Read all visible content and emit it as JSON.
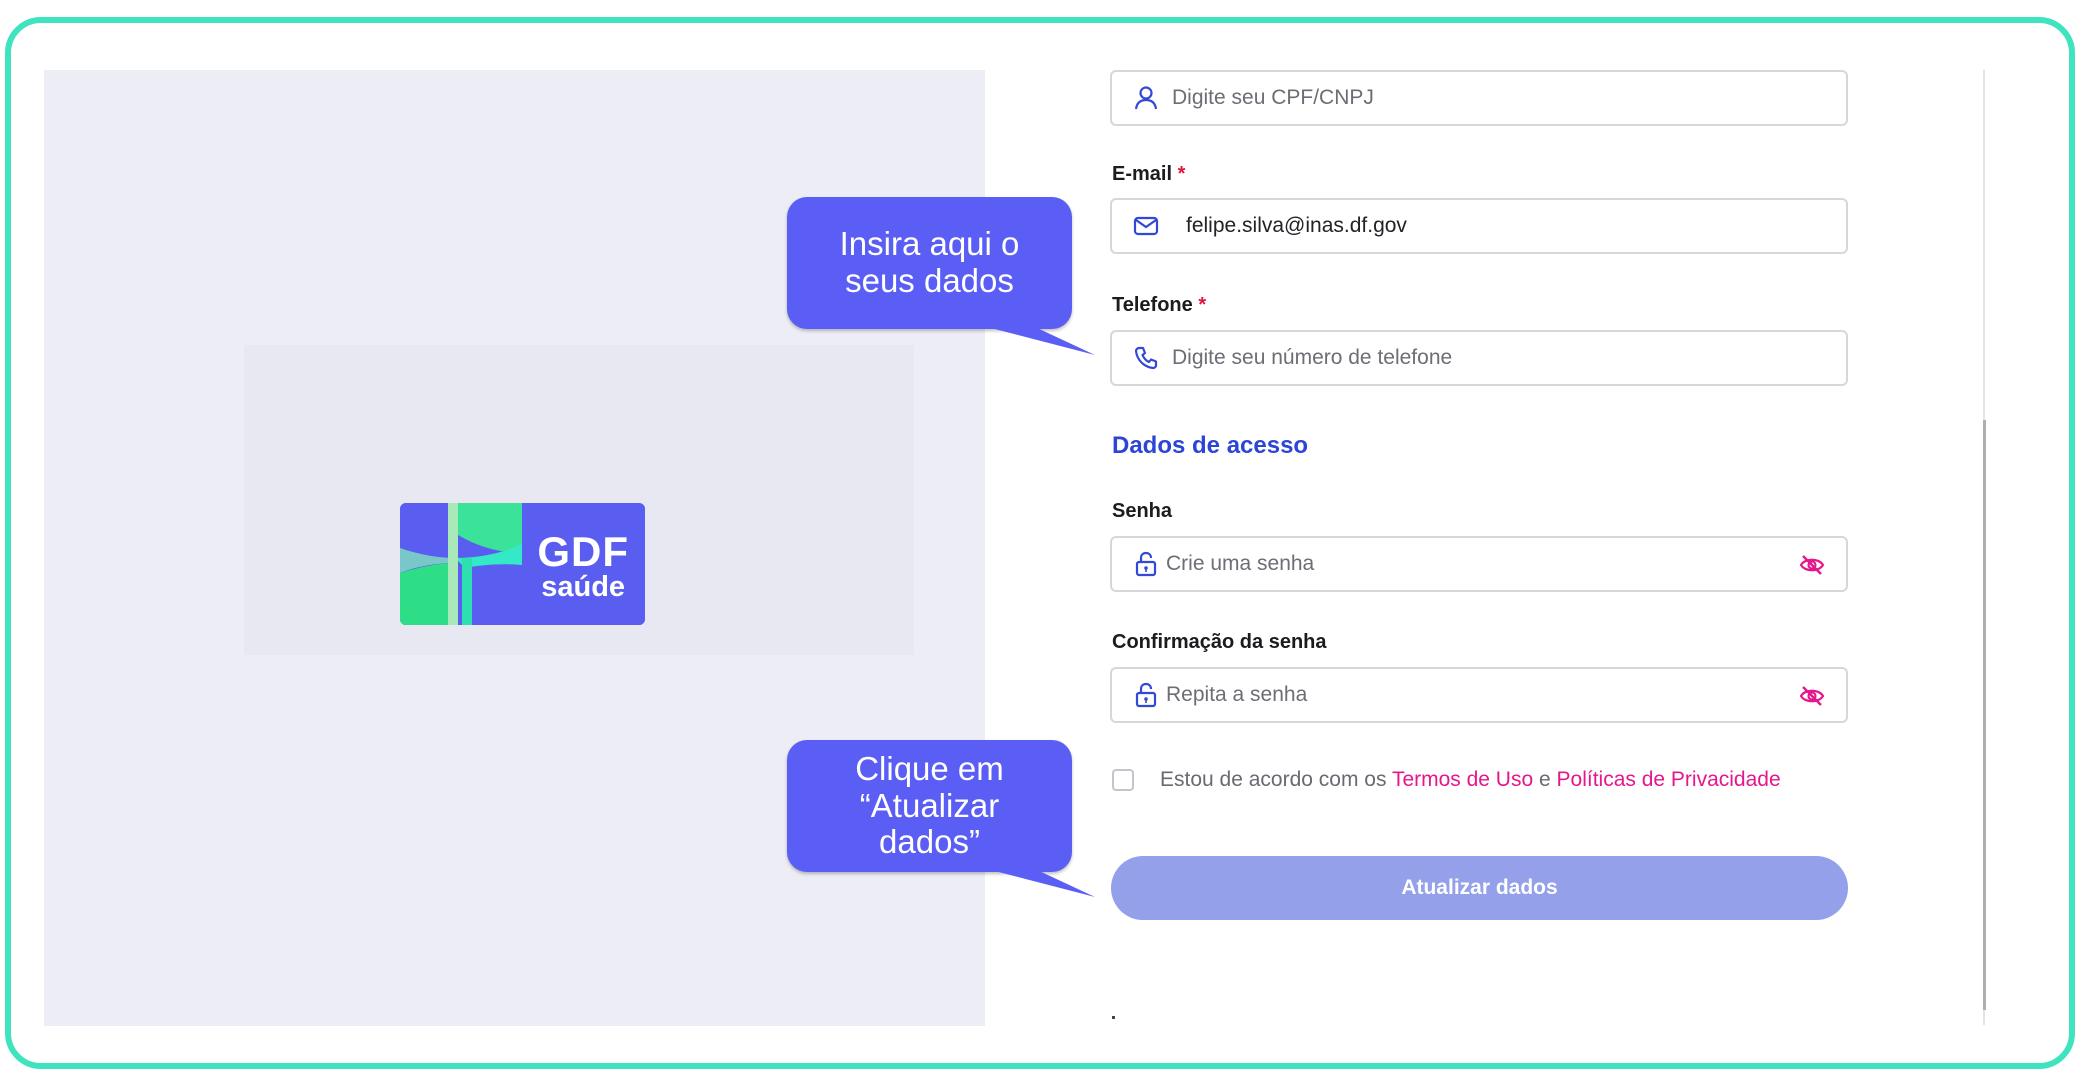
{
  "logo": {
    "line1": "GDF",
    "line2": "saúde",
    "bg_color": "#5a5ef0",
    "accent_colors": [
      "#3be39a",
      "#1fd7b8"
    ]
  },
  "callouts": {
    "data_hint": "Insira aqui o seus dados",
    "submit_hint": "Clique em “Atualizar dados”"
  },
  "form": {
    "cpf": {
      "placeholder": "Digite seu CPF/CNPJ",
      "icon": "user-icon"
    },
    "email": {
      "label": "E-mail",
      "required_mark": "*",
      "value": "felipe.silva@inas.df.gov",
      "icon": "mail-icon"
    },
    "phone": {
      "label": "Telefone",
      "required_mark": "*",
      "placeholder": "Digite seu número de telefone",
      "icon": "phone-icon"
    },
    "section_title": "Dados de acesso",
    "password": {
      "label": "Senha",
      "placeholder": "Crie uma senha",
      "icon": "lock-icon",
      "toggle_icon": "eye-off-icon"
    },
    "confirm": {
      "label": "Confirmação da senha",
      "placeholder": "Repita a senha",
      "icon": "lock-icon",
      "toggle_icon": "eye-off-icon"
    },
    "terms": {
      "prefix": "Estou de acordo com os",
      "terms_link": "Termos de Uso",
      "conjunction": "e",
      "privacy_link": "Políticas de Privacidade",
      "checked": false
    },
    "submit_label": "Atualizar dados"
  },
  "colors": {
    "frame": "#3fe3c0",
    "primary": "#5b5ef4",
    "section": "#2d45d6",
    "link": "#e6178c",
    "required": "#e0143c",
    "button_disabled": "#94a0ea"
  }
}
